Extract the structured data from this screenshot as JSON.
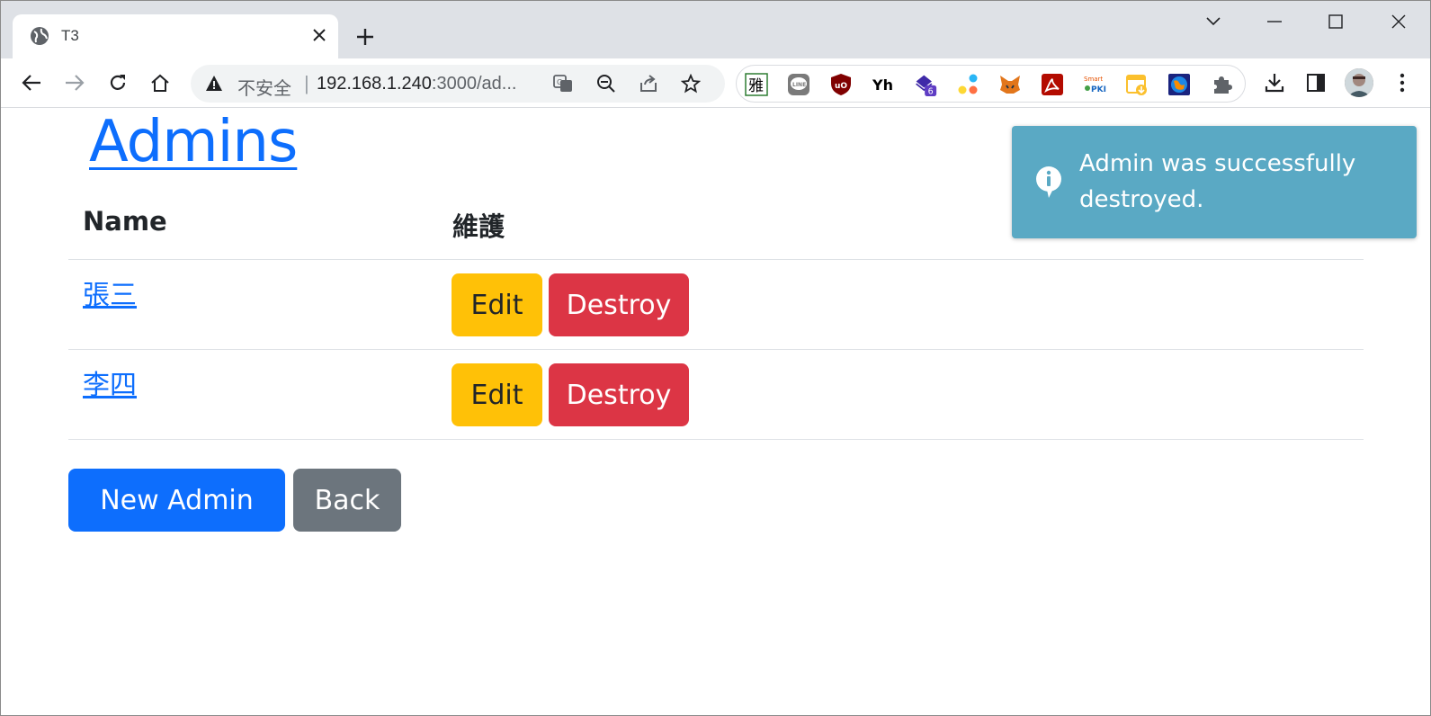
{
  "browser": {
    "tab_title": "T3",
    "security_label": "不安全",
    "url_host": "192.168.1.240",
    "url_path": ":3000/ad...",
    "extension_badge": "6",
    "extensions": [
      "yahoo-dictionary-icon",
      "line-icon",
      "ublock-icon",
      "yh-icon",
      "stack-extension-icon",
      "dots-icon",
      "metamask-icon",
      "acrobat-icon",
      "smartpki-icon",
      "calendar-download-icon",
      "globe-extension-icon",
      "puzzle-extensions-icon"
    ]
  },
  "page": {
    "title": "Admins",
    "table": {
      "headers": [
        "Name",
        "維護"
      ],
      "rows": [
        {
          "name": "張三",
          "edit": "Edit",
          "destroy": "Destroy"
        },
        {
          "name": "李四",
          "edit": "Edit",
          "destroy": "Destroy"
        }
      ]
    },
    "actions": {
      "new_label": "New Admin",
      "back_label": "Back"
    }
  },
  "toast": {
    "message": "Admin was successfully destroyed.",
    "color": "#5aa9c4"
  },
  "colors": {
    "primary": "#0d6efd",
    "warning": "#ffc107",
    "danger": "#dc3545",
    "secondary": "#6c757d"
  }
}
